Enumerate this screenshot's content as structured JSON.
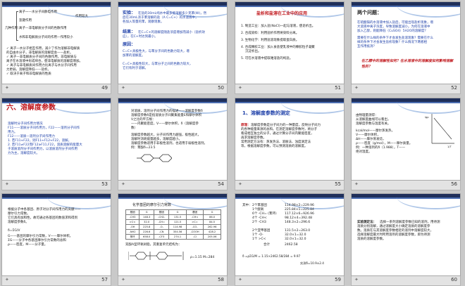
{
  "slides": [
    {
      "number": "49",
      "lines": [
        "离子一—水分子间静电作用",
        "作用较大",
        "氢键作用",
        "几种作用：",
        "离子—非电解质分子间的色散作用",
        "水和非电解质分子间的作用—作用较小",
        "✓ 离子—水分子相互作用，减少了作为溶解非电解质",
        "的自由水分子，非电解质的溶解度会——盐析。",
        "✓ 离子—非电解质分子间的色散作用，非电解质与",
        "离子在水溶液中形成缔合，使非电解质的溶解度增加。",
        "✓ 离子与非电解质间作用力比离子与水分子间作用",
        "力更弱，溶解度降低——盐析。",
        "✓ 取决于离子和非电解质的性质"
      ]
    },
    {
      "number": "50",
      "lines": [
        "实验：",
        "在盐的30mL纯水中最多能溶解多少克苯(W)，然",
        "后在30mL浓于苯溶解的盐（A C=C+）的水溶液中，",
        "各加入等量的苯，观察现象。",
        "结果：",
        "在C=C+的溶解度随盐浓度增加而减小（盐析效",
        "应），在C+时达到最小。",
        "原因：",
        "C=C+具极性大，与苯分子间的色散力较大，增",
        "加苯的溶解度。",
        "C=C+具极性较大，与苯分子之间的色散力较大，",
        "它们有利于溶解。"
      ]
    },
    {
      "number": "51",
      "title": "盐析和盐溶在工业中的应用",
      "lines": [
        "1. 制造工业：加入盐(NaCl)一起与溶液，使皂析出。",
        "2. 合成染料：利用盐析作用将染料分离。",
        "3. 生物化学：利用盐溶现象提取蛋白质。",
        "4. 合成橡胶工业：加入食盐使乳液中的橡胶粒子凝聚",
        "沉淀析出。",
        "5. 可在水溶液中提取难溶盐的纯盐。"
      ]
    },
    {
      "number": "52",
      "title": "两个问题：",
      "lines": [
        "在硫酸铵的水溶液中加入盐后，可能出现盐析现象，增",
        "大溶液中离子浓度，导致溶解度减小。为何在溶液中",
        "加入乙醇，则能降低（CuSO4）5H2O的溶解度？",
        "需要在什么样的条件下才会发生盐溶现象？需要在什么",
        "样的条件下才会发生盐析现象？什么情况下两者相",
        "互作用抵消？"
      ],
      "question": "在乙醇中的溶解性如何？在水溶液中的溶解度如何影响溶解性的？"
    },
    {
      "number": "53",
      "title": "六、溶解度参数",
      "lines": [
        "溶解时分子间作用力情况",
        "F11——溶质分子间作用力，F22——溶剂分子间作",
        "用力。",
        "F12——溶质—溶剂分子间作用力",
        "1. 若F11≈F22，则F11≈F12≈F22，溶解。",
        "2. 若F11≠F22而F12≥F11,F22，溶质溶解的能量大",
        "于溶质溶剂分子间作用力，以溶质溶剂分子间作用",
        "力为主，溶解度较大。"
      ]
    },
    {
      "number": "54",
      "lines": [
        "对溶质、溶剂分子间作用力的描述——溶解度参数δ",
        "溶解度参数δ是指溶质分子间聚集能量E和摩尔体积",
        "V之比的平方根：",
        "——内聚能密度，V——摩尔体积，δ（溶解度参",
        "数）",
        "溶解度参数越大，分子间作用力越强，极性越大，",
        "溶解时消耗能量越多，溶解度越小。",
        "溶解度参数适用于非极性溶剂，也适用于弱极性溶剂。",
        "例：苯酚δ=23.5"
      ]
    },
    {
      "number": "55",
      "title": "1、溶解度参数的测定",
      "lines": [
        "原理：",
        "溶解度参数是分子间力的一种量度，反映分子间力",
        "的各种能量来源的总和。在测定溶解度参数时，将分子",
        "看成相互独立的分子，通过计算分子间内聚能密度，",
        "再求溶解度参数。",
        "常用测定方法有：蒸发热法、溶胀法、浊度滴定法",
        "等，根据溶解度参数，可以预测溶质的溶解度。"
      ]
    },
    {
      "number": "56",
      "lines": [
        "由物理量测得：",
        "从溶解度曲线可以看出，",
        "溶解度参数与温度有关。",
        "kcal/mol——摩尔蒸发热，",
        "V——摩尔体积，",
        "ΔH——摩尔蒸发焓，",
        "ρ——密度（g/mol），M——摩尔质量。",
        "例：一种溶剂的δ（1.988），T——",
        "绝对温度。"
      ],
      "chart_ylabel": "lgp",
      "chart_xlabel": "1/T"
    },
    {
      "number": "57",
      "lines": [
        "根据分子中各基团、原子对分子间作用力的贡献——",
        "摩尔引力常数。",
        "它们具有加和性，故可通过各基团的数值求和得到",
        "溶解度参数δ。",
        "δ=ΣG/V",
        "G——基团的摩尔引力常数，V——摩尔体积。",
        "ΣG——分子中各基团摩尔引力常数的总和",
        "ρ——密度，M——分子量。"
      ]
    },
    {
      "number": "58",
      "title": "化学基团的摩尔引力常数",
      "table": [
        [
          "基团",
          "G",
          "基团",
          "G",
          "基团",
          "G"
        ],
        [
          "-CH3",
          "148.3",
          "-CH2-",
          "131.5",
          "-CH<",
          "86.0"
        ],
        [
          ">C<",
          "32.0",
          "-CH=",
          "121.5",
          ">C=",
          "84.5"
        ],
        [
          "-OH",
          "225.8",
          "-O-",
          "114.98",
          "-CO-",
          "262.96"
        ],
        [
          "-NH2",
          "226.6",
          "-CN",
          "354.56",
          "-COOH",
          "428.2"
        ],
        [
          "苯环",
          "658.0",
          "-CF3",
          "274.1",
          "-Cl",
          "205.06"
        ]
      ],
      "lines": [
        "双酚A型环氧树脂，其重复单元结构为：",
        "ρ=1.15",
        "M=284"
      ]
    },
    {
      "number": "59",
      "lines": [
        "其中：",
        "2个苯基团",
        "114.98×2=229.96",
        "1个醚氧",
        "225.84×1=225.84",
        "6个 -CH= (苯环)",
        "117.12×6=926.96",
        "4个 -CH<",
        "98.12×4=392.48",
        "2个 -CH3",
        "148.3×2=296.6",
        "2个亚甲基团",
        "131.5×2=263.0",
        "1个 -O-",
        "32.0×1=32.0",
        "1个 >C<",
        "32.0×1=32.0",
        "合计",
        "2462.58",
        "δ =ρΣG/M = 1.15×2462.58/284 = 9.97",
        "实测δ=10.9±2.4"
      ]
    },
    {
      "number": "60",
      "lines": [
        "实验测定法：",
        "选择一系列溶解度参数已知的溶剂，用待测",
        "溶质分别溶解，通过溶解度大小确定溶质的溶解度参",
        "数。溶质在与其溶解度参数相近的溶剂中溶解度较大，",
        "选择溶解度最大时所用溶剂的溶解度参数，即为待测",
        "溶质的溶解度参数。"
      ]
    }
  ]
}
